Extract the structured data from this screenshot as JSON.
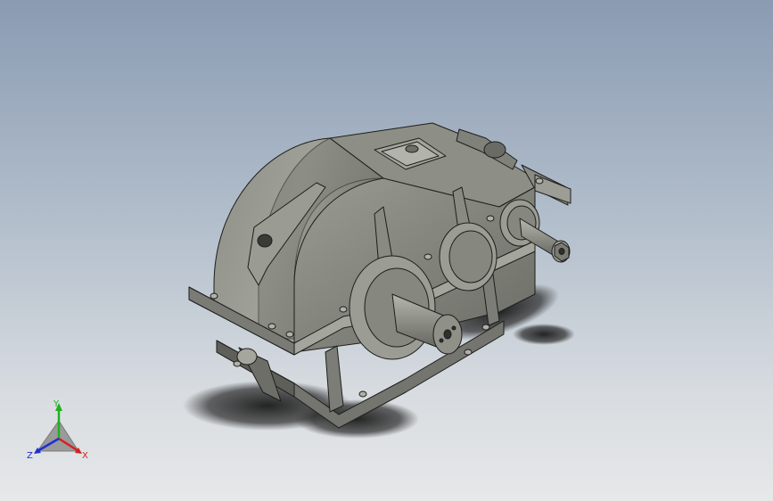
{
  "viewport": {
    "model": "gear-reducer-assembly",
    "background_top": "#8a9bb2",
    "background_bottom": "#e6e8e9",
    "model_color": "#7f8078",
    "edge_color": "#1e1e1c"
  },
  "triad": {
    "x_label": "X",
    "y_label": "Y",
    "z_label": "Z",
    "x_color": "#d42020",
    "y_color": "#20b020",
    "z_color": "#2030d0"
  }
}
